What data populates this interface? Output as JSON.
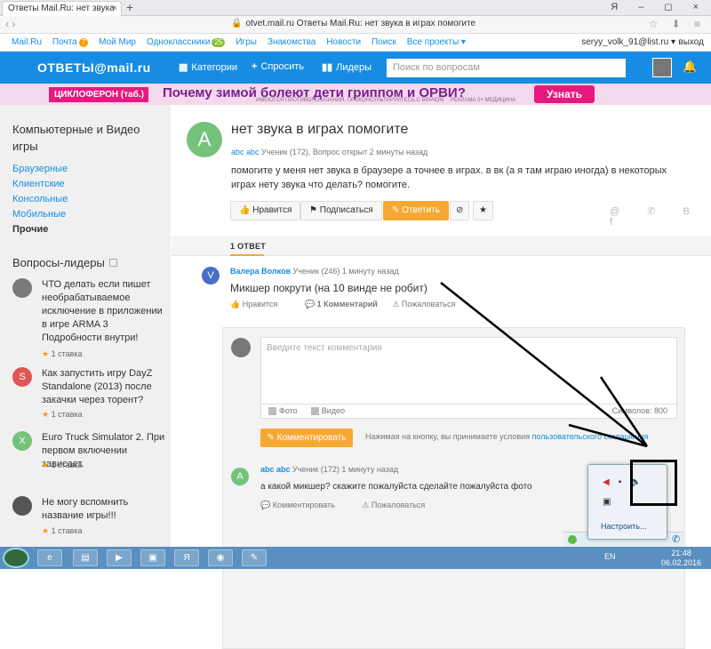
{
  "browser": {
    "tab_title": "Ответы Mail.Ru: нет звука",
    "tab_close": "×",
    "new_tab": "+",
    "window_controls": "Я – ◻ ×",
    "address": "otvet.mail.ru  Ответы Mail.Ru: нет звука в играх помогите",
    "nav": "‹ ›",
    "right_icons": "☆ ⬇ ≡"
  },
  "portal": {
    "links": [
      "Mail.Ru",
      "Почта",
      "Мой Мир",
      "Одноклассники",
      "Игры",
      "Знакомства",
      "Новости",
      "Поиск",
      "Все проекты ▾"
    ],
    "mail_badge": "7",
    "ok_badge": "25",
    "user": "seryy_volk_91@list.ru ▾",
    "exit": "выход"
  },
  "header": {
    "logo": "ОТВЕТЫ@mail.ru",
    "categories": "Категории",
    "ask": "Спросить",
    "leaders": "Лидеры",
    "search_placeholder": "Поиск по вопросам",
    "bell": "🔔"
  },
  "banner": {
    "brand": "ЦИКЛОФЕРОН (таб.)",
    "headline": "Почему зимой болеют дети гриппом и ОРВИ?",
    "sub": "ИМЕЮТСЯ ПРОТИВОПОКАЗАНИЯ. ПРОКОНСУЛЬТИРУЙТЕСЬ С ВРАЧОМ",
    "sub2": "РЕКЛАМА 0+ МЕДИЦИНА",
    "cta": "Узнать"
  },
  "sidebar": {
    "category_title": "Компьютерные и Видео игры",
    "links": [
      "Браузерные",
      "Клиентские",
      "Консольные",
      "Мобильные"
    ],
    "current": "Прочие",
    "leaders_title": "Вопросы-лидеры",
    "questions": [
      {
        "avatar_letter": "",
        "avatar_color": "#7a7a7a",
        "text": "ЧТО делать если пишет необрабатываемое исключение в приложении в игре ARMA 3 Подробности внутри!",
        "rate": "1 ставка"
      },
      {
        "avatar_letter": "S",
        "avatar_color": "#e05555",
        "text": "Как запустить игру DayZ Standalone (2013) после закачки через торент?",
        "rate": "1 ставка"
      },
      {
        "avatar_letter": "X",
        "avatar_color": "#74c27b",
        "text": "Euro Truck Simulator 2. При первом включении зависает.",
        "rate": "1 ставка"
      },
      {
        "avatar_letter": "",
        "avatar_color": "#555555",
        "text": "Не могу вспомнить название игры!!!",
        "rate": "1 ставка"
      }
    ]
  },
  "question": {
    "avatar_letter": "A",
    "title": "нет звука в играх помогите",
    "author": "abc abc",
    "meta": "Ученик (172), Вопрос открыт 2 минуты назад",
    "text": "помогите у меня нет звука в браузере а точнее в играх. в вк (а я там играю иногда) в некоторых играх нету звука что делать? помогите.",
    "like": "Нравится",
    "subscribe": "Подписаться",
    "answer": "Ответить",
    "share_icons": "@ ✆ B f"
  },
  "answers": {
    "count_label": "1 ОТВЕТ",
    "item": {
      "avatar_letter": "V",
      "author": "Валера Волков",
      "meta": "Ученик (246)  1 минуту назад",
      "text": "Микшер покрути (на 10 винде не робит)",
      "like": "Нравится",
      "comments": "1 Комментарий",
      "report": "Пожаловаться"
    }
  },
  "comment_form": {
    "placeholder": "Введите текст комментария",
    "photo": "Фото",
    "video": "Видео",
    "counter": "Символов: 800",
    "submit": "Комментировать",
    "note": "Нажимая на кнопку, вы принимаете условия",
    "note_link": "пользовательского соглашения"
  },
  "comment": {
    "avatar_letter": "A",
    "author": "abc abc",
    "meta": "Ученик (172)  1 минуту назад",
    "text": "а какой микшер? скажите пожалуйста сделайте пожалуйста фото",
    "action_comment": "Комментировать",
    "action_report": "Пожаловаться"
  },
  "tray_popup": {
    "setup": "Настроить..."
  },
  "taskbar": {
    "lang": "EN",
    "time": "21:48",
    "date": "06.02.2016"
  }
}
